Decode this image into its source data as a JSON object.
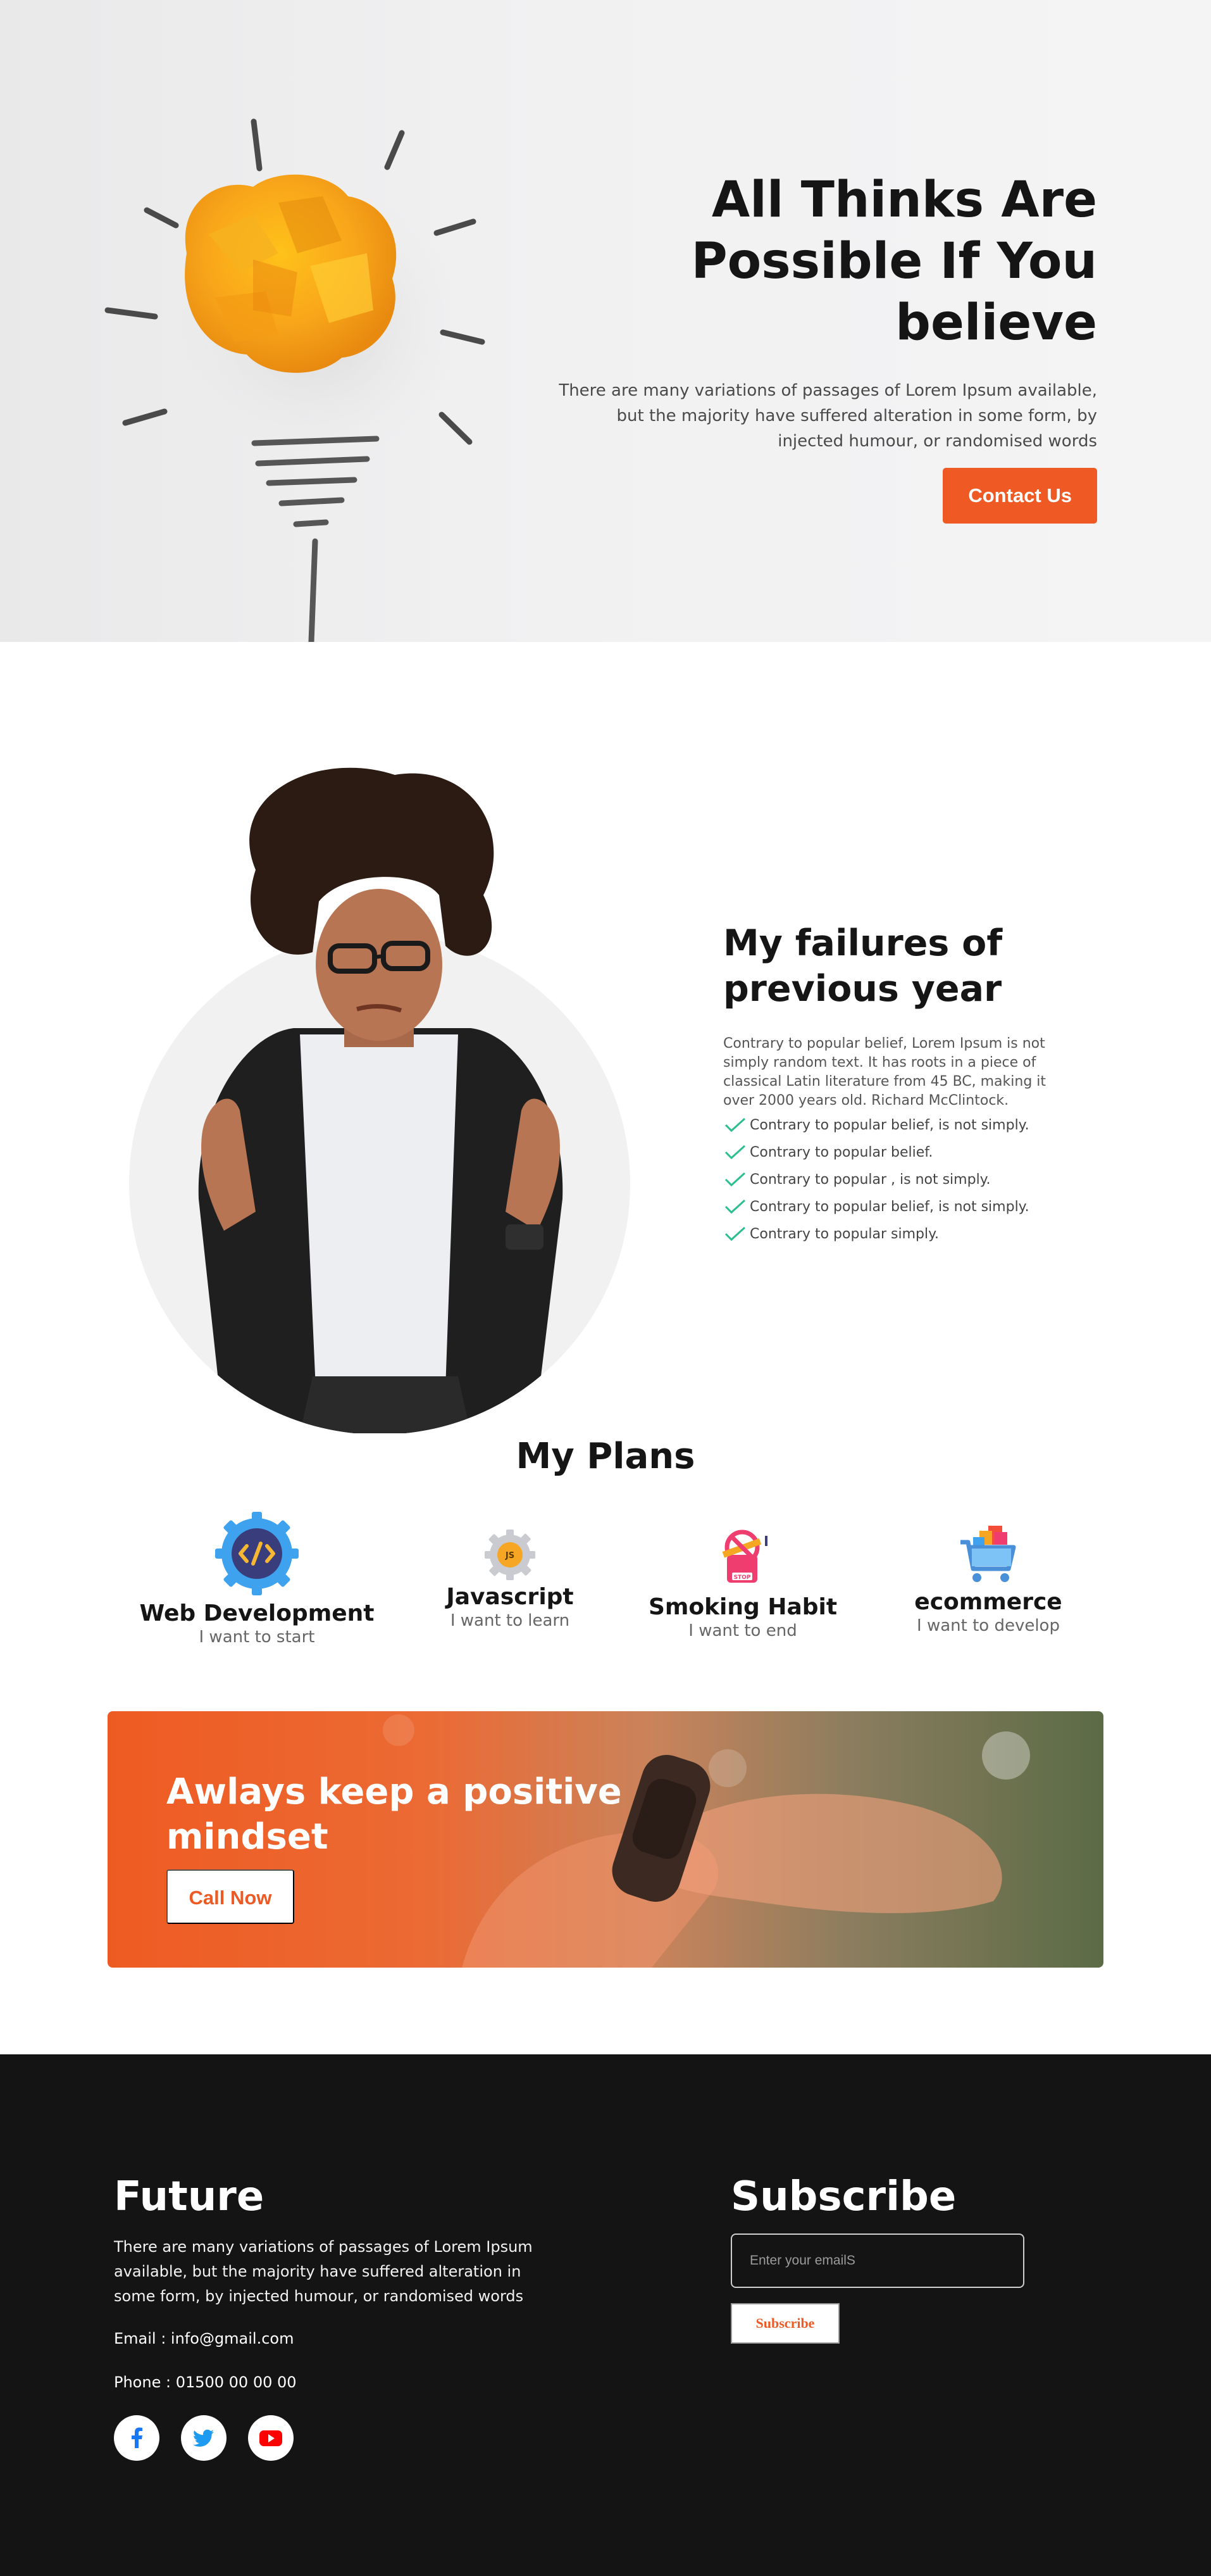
{
  "hero": {
    "title_line1": "All Thinks Are",
    "title_line2": "Possible If You",
    "title_line3": "believe",
    "text": "There are many variations of passages of Lorem Ipsum available, but the majority have suffered alteration in some form, by injected humour, or randomised words",
    "button": "Contact Us",
    "image_icon": "crumpled-paper-lightbulb-icon"
  },
  "failures": {
    "title": "My failures of previous year",
    "text": "Contrary to popular belief, Lorem Ipsum is not simply random text. It has roots in a piece of classical Latin literature from 45 BC, making it over 2000 years old. Richard McClintock.",
    "items": [
      "Contrary to popular belief, is not simply.",
      "Contrary to popular belief.",
      "Contrary to popular , is not simply.",
      "Contrary to popular belief, is not simply.",
      "Contrary to popular simply."
    ],
    "image_icon": "confused-woman-photo"
  },
  "plans": {
    "title": "My Plans",
    "items": [
      {
        "name": "Web Development",
        "sub": "I want to start",
        "icon": "code-gear-icon"
      },
      {
        "name": "Javascript",
        "sub": "I want to learn",
        "icon": "js-gear-icon"
      },
      {
        "name": "Smoking Habit",
        "sub": "I want to end",
        "icon": "no-smoking-icon"
      },
      {
        "name": "ecommerce",
        "sub": "I want to develop",
        "icon": "shopping-cart-icon"
      }
    ]
  },
  "banner": {
    "title": "Awlays keep a positive mindset",
    "button": "Call Now"
  },
  "footer": {
    "title": "Future",
    "text": "There are many variations of passages of Lorem Ipsum available, but the majority have suffered alteration in some form, by injected humour, or randomised words",
    "email": "Email : info@gmail.com",
    "phone": "Phone : 01500 00 00 00",
    "socials": [
      "facebook-icon",
      "twitter-icon",
      "youtube-icon"
    ],
    "subscribe_title": "Subscribe",
    "email_placeholder": "Enter your emailS",
    "subscribe_button": "Subscribe"
  },
  "colors": {
    "accent": "#ef5a24",
    "check": "#2bbf8c",
    "footer_bg": "#141414"
  }
}
